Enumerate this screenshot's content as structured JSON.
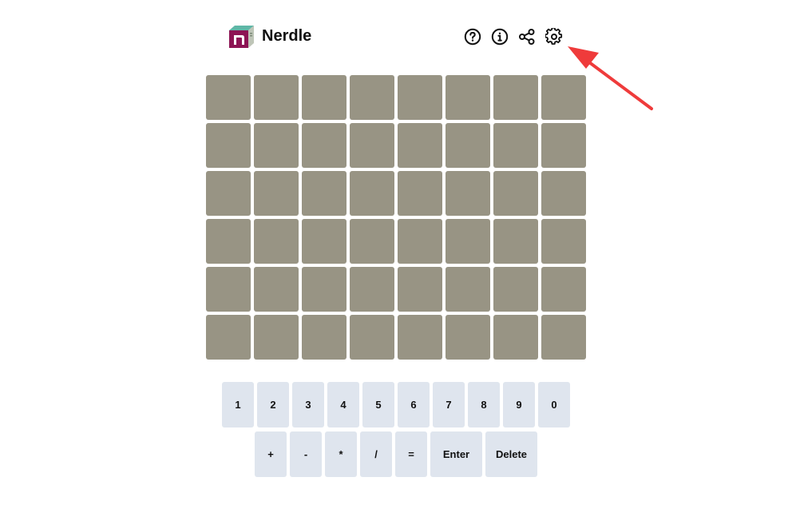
{
  "header": {
    "title": "Nerdle",
    "logo_letter": "n",
    "icons": [
      "help-icon",
      "info-icon",
      "share-icon",
      "settings-icon"
    ]
  },
  "board": {
    "rows": 6,
    "columns": 8,
    "tile_color": "#989484"
  },
  "keyboard": {
    "row1": [
      "1",
      "2",
      "3",
      "4",
      "5",
      "6",
      "7",
      "8",
      "9",
      "0"
    ],
    "row2": [
      "+",
      "-",
      "*",
      "/",
      "=",
      "Enter",
      "Delete"
    ],
    "key_color": "#dfe5ee"
  },
  "annotation": {
    "arrow_color": "#ef3b3b",
    "points_to": "settings-icon"
  }
}
